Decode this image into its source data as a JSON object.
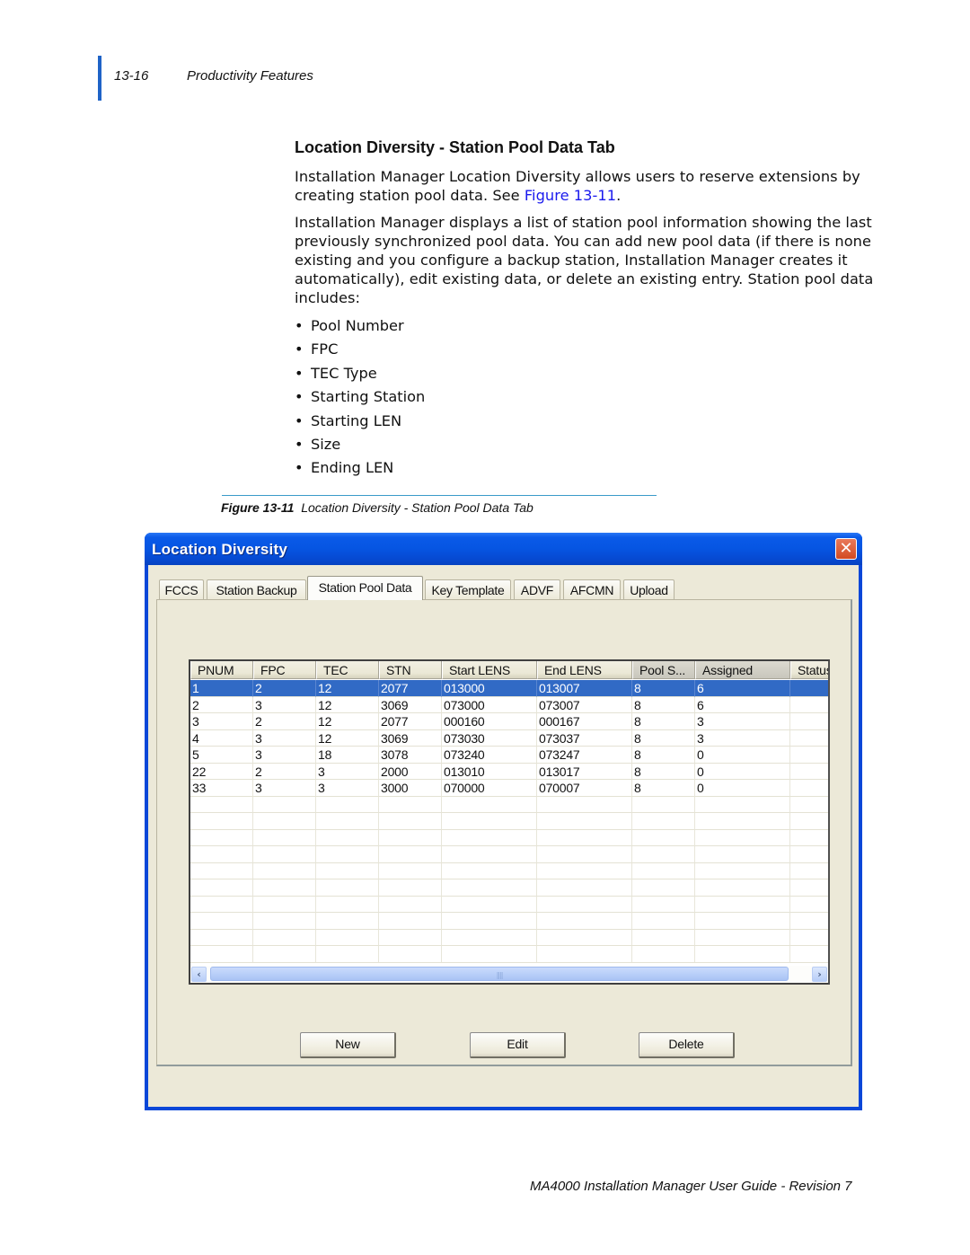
{
  "running_head": {
    "page_number": "13-16",
    "section": "Productivity Features"
  },
  "section_title": "Location Diversity - Station Pool Data Tab",
  "para1": {
    "text": "Installation Manager Location Diversity allows users to reserve extensions by creating station pool data. See ",
    "link": "Figure 13-11",
    "after": "."
  },
  "para2": "Installation Manager displays a list of station pool information showing the last previously synchronized pool data. You can add new pool data (if there is none existing and you configure a backup station, Installation Manager creates it automatically), edit existing data, or delete an existing entry. Station pool data includes:",
  "bullets": [
    "Pool Number",
    "FPC",
    "TEC Type",
    "Starting Station",
    "Starting LEN",
    "Size",
    "Ending LEN"
  ],
  "bullet_glyph": "•",
  "figure": {
    "label": "Figure 13-11",
    "caption": "Location Diversity - Station Pool Data Tab"
  },
  "dialog": {
    "title": "Location Diversity",
    "close_icon": "✕",
    "tabs": [
      "FCCS",
      "Station Backup",
      "Station Pool Data",
      "Key Template",
      "ADVF",
      "AFCMN",
      "Upload"
    ],
    "active_tab": "Station Pool Data",
    "columns": [
      "PNUM",
      "FPC",
      "TEC",
      "STN",
      "Start LENS",
      "End LENS",
      "Pool S...",
      "Assigned",
      "Status"
    ],
    "rows": [
      [
        "1",
        "2",
        "12",
        "2077",
        "013000",
        "013007",
        "8",
        "6",
        ""
      ],
      [
        "2",
        "3",
        "12",
        "3069",
        "073000",
        "073007",
        "8",
        "6",
        ""
      ],
      [
        "3",
        "2",
        "12",
        "2077",
        "000160",
        "000167",
        "8",
        "3",
        ""
      ],
      [
        "4",
        "3",
        "12",
        "3069",
        "073030",
        "073037",
        "8",
        "3",
        ""
      ],
      [
        "5",
        "3",
        "18",
        "3078",
        "073240",
        "073247",
        "8",
        "0",
        ""
      ],
      [
        "22",
        "2",
        "3",
        "2000",
        "013010",
        "013017",
        "8",
        "0",
        ""
      ],
      [
        "33",
        "3",
        "3",
        "3000",
        "070000",
        "070007",
        "8",
        "0",
        ""
      ]
    ],
    "selected_row": 0,
    "empty_rows": 10,
    "scrollbar": {
      "left_icon": "‹",
      "right_icon": "›",
      "grip": "||||"
    },
    "buttons": {
      "new": "New",
      "edit": "Edit",
      "delete": "Delete"
    }
  },
  "footer": "MA4000 Installation Manager User Guide - Revision 7"
}
